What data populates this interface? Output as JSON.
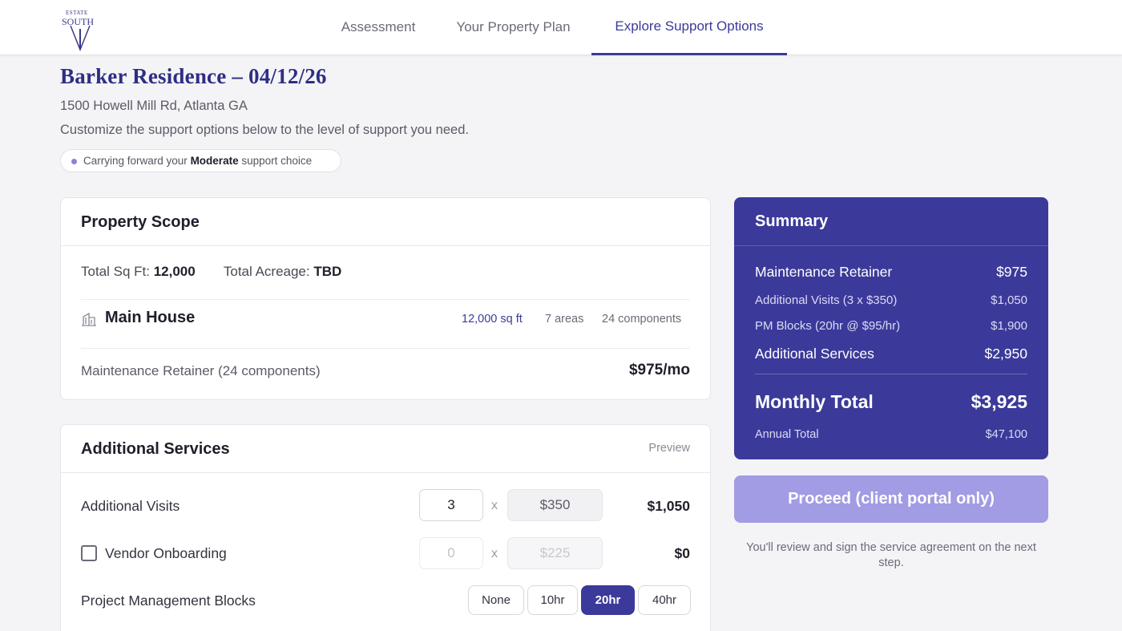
{
  "brand": {
    "line1": "ESTATE",
    "line2": "SOUTH"
  },
  "nav": {
    "tabs": [
      {
        "label": "Assessment"
      },
      {
        "label": "Your Property Plan"
      },
      {
        "label": "Explore Support Options"
      }
    ],
    "active_tab": "Explore Support Options"
  },
  "header": {
    "title": "Barker Residence – 04/12/26",
    "address": "1500 Howell Mill Rd, Atlanta GA",
    "description": "Customize the support options below to the level of support you need.",
    "pill": {
      "prefix": "Carrying forward your",
      "choice": "Moderate",
      "suffix": "support choice"
    }
  },
  "scope": {
    "title": "Property Scope",
    "sqft_label": "Total Sq Ft:",
    "sqft_value": "12,000",
    "acreage_label": "Total Acreage:",
    "acreage_value": "TBD",
    "house": {
      "name": "Main House",
      "sqft": "12,000 sq ft",
      "areas": "7 areas",
      "components": "24 components"
    },
    "retainer_label": "Maintenance Retainer (24 components)",
    "retainer_price": "$975/mo"
  },
  "services": {
    "title": "Additional Services",
    "preview": "Preview",
    "visits": {
      "label": "Additional Visits",
      "qty": "3",
      "times": "x",
      "rate": "$350",
      "amount": "$1,050"
    },
    "vendor": {
      "label": "Vendor Onboarding",
      "checked": false,
      "qty": "0",
      "times": "x",
      "rate": "$225",
      "amount": "$0"
    },
    "pm": {
      "label": "Project Management Blocks",
      "options": [
        "None",
        "10hr",
        "20hr",
        "40hr"
      ],
      "selected": "20hr"
    }
  },
  "summary": {
    "title": "Summary",
    "rows": [
      {
        "label": "Maintenance Retainer",
        "value": "$975"
      },
      {
        "label": "Additional Visits (3 x $350)",
        "value": "$1,050"
      },
      {
        "label": "PM Blocks (20hr @ $95/hr)",
        "value": "$1,900"
      },
      {
        "label": "Additional Services",
        "value": "$2,950"
      }
    ],
    "monthly_label": "Monthly Total",
    "monthly_value": "$3,925",
    "annual_label": "Annual Total",
    "annual_value": "$47,100"
  },
  "proceed_label": "Proceed (client portal only)",
  "note": "You'll review and sign the service agreement on the next step.",
  "colors": {
    "accent": "#3b3a9a",
    "proceed_disabled": "#a19ce3",
    "page_bg": "#f4f4f7"
  },
  "icons": [
    "brand-logo-icon",
    "building-icon",
    "checkbox-icon"
  ]
}
